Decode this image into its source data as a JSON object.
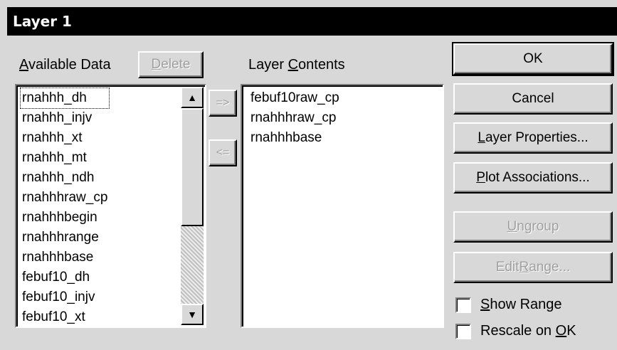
{
  "window": {
    "title": "Layer 1"
  },
  "available": {
    "label_prefix": "",
    "label_underlined": "A",
    "label_suffix": "vailable Data",
    "delete_prefix": "",
    "delete_underlined": "D",
    "delete_suffix": "elete",
    "items": [
      "rnahhh_dh",
      "rnahhh_injv",
      "rnahhh_xt",
      "rnahhh_mt",
      "rnahhh_ndh",
      "rnahhhraw_cp",
      "rnahhhbegin",
      "rnahhhrange",
      "rnahhhbase",
      "febuf10_dh",
      "febuf10_injv",
      "febuf10_xt"
    ]
  },
  "move": {
    "add_label": "=>",
    "remove_label": "<="
  },
  "contents": {
    "label_prefix": "Layer ",
    "label_underlined": "C",
    "label_suffix": "ontents",
    "items": [
      "febuf10raw_cp",
      "rnahhhraw_cp",
      "rnahhhbase"
    ]
  },
  "buttons": {
    "ok": "OK",
    "cancel": "Cancel",
    "layer_props_u": "L",
    "layer_props_rest": "ayer Properties...",
    "plot_assoc_u": "P",
    "plot_assoc_rest": "lot Associations...",
    "ungroup_u": "U",
    "ungroup_rest": "ngroup",
    "edit_range_pre": "Edit ",
    "edit_range_u": "R",
    "edit_range_rest": "ange..."
  },
  "options": {
    "show_range_u": "S",
    "show_range_rest": "how Range",
    "show_range_checked": false,
    "rescale_pre": "Rescale on ",
    "rescale_u": "O",
    "rescale_rest": "K",
    "rescale_checked": false
  },
  "icons": {
    "scroll_up": "scroll-up-arrow-icon",
    "scroll_down": "scroll-down-arrow-icon"
  }
}
